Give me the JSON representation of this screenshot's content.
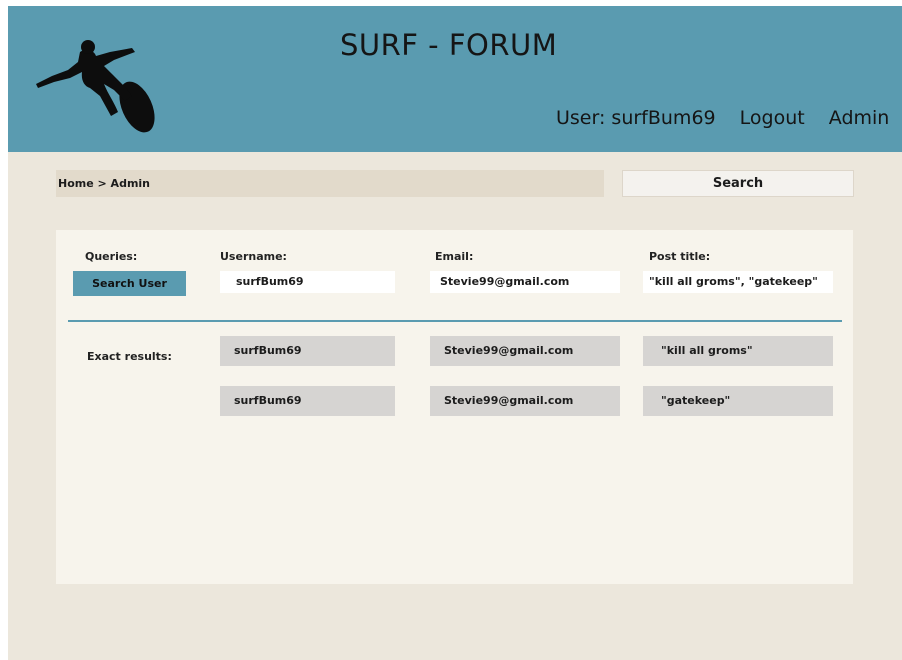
{
  "header": {
    "site_title": "SURF - FORUM",
    "user_label": "User: surfBum69",
    "logout": "Logout",
    "admin": "Admin",
    "color": "#5a9bb0",
    "logo_icon": "surfer-silhouette-icon"
  },
  "breadcrumb": "Home > Admin",
  "top_search_label": "Search",
  "queries": {
    "queries_label": "Queries:",
    "search_user_button": "Search User",
    "username_label": "Username:",
    "email_label": "Email:",
    "post_title_label": "Post title:",
    "username_value": "surfBum69",
    "email_value": "Stevie99@gmail.com",
    "post_title_value": "\"kill all groms\", \"gatekeep\""
  },
  "results": {
    "label": "Exact results:",
    "rows": [
      {
        "username": "surfBum69",
        "email": "Stevie99@gmail.com",
        "post_title": "\"kill all groms\""
      },
      {
        "username": "surfBum69",
        "email": "Stevie99@gmail.com",
        "post_title": "\"gatekeep\""
      }
    ]
  }
}
